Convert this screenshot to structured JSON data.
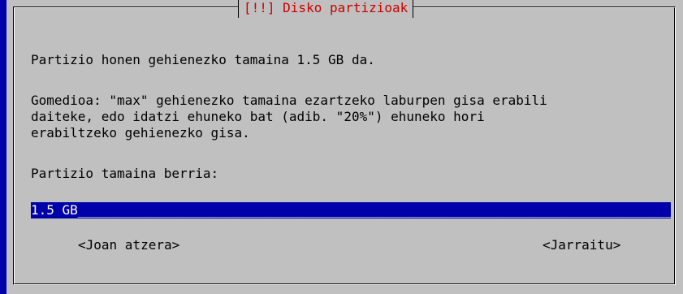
{
  "dialog": {
    "title": "[!!] Disko partizioak",
    "line1": "Partizio honen gehienezko tamaina 1.5 GB da.",
    "hint_l1": "Gomedioa: \"max\" gehienezko tamaina ezartzeko laburpen gisa erabili",
    "hint_l2": "daiteke, edo idatzi ehuneko bat (adib. \"20%\") ehuneko hori",
    "hint_l3": "erabiltzeko gehienezko gisa.",
    "prompt": "Partizio tamaina berria:",
    "input_value": "1.5 GB",
    "input_fill": "______________________________________________________________________________________",
    "back_button": "<Joan atzera>",
    "continue_button": "<Jarraitu>"
  },
  "colors": {
    "background": "#0000aa",
    "dialog": "#c0c0c0",
    "title": "#cc0000",
    "field": "#0000aa"
  }
}
